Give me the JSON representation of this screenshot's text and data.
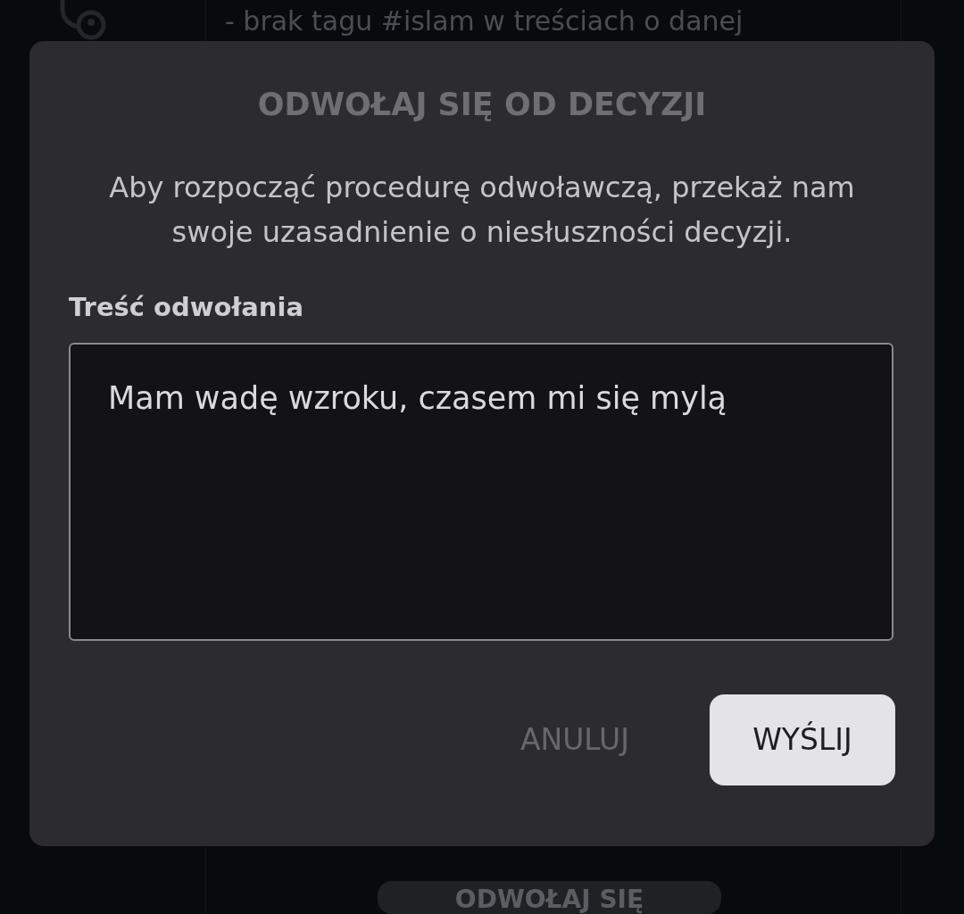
{
  "background": {
    "text": "- brak tagu #islam w treściach o danej",
    "button": "ODWOŁAJ SIĘ"
  },
  "dialog": {
    "title": "ODWOŁAJ SIĘ OD DECYZJI",
    "message": "Aby rozpocząć procedurę odwoławczą, przekaż nam swoje uzasadnienie o niesłuszności decyzji.",
    "field": {
      "label": "Treść odwołania",
      "value": "Mam wadę wzroku, czasem mi się mylą"
    },
    "buttons": [
      {
        "label": "ANULUJ",
        "kind": "text"
      },
      {
        "label": "WYŚLIJ",
        "kind": "filled"
      }
    ]
  }
}
